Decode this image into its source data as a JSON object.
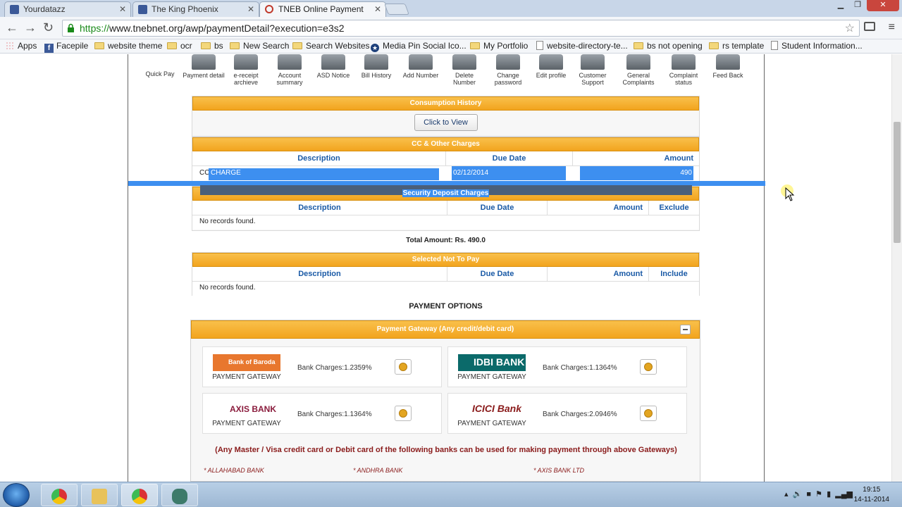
{
  "browser": {
    "tabs": [
      {
        "title": "Yourdatazz",
        "fav_color": "#3b5998"
      },
      {
        "title": "The King Phoenix",
        "fav_color": "#3b5998"
      },
      {
        "title": "TNEB Online Payment",
        "fav_color": "#c0392b"
      }
    ],
    "url_scheme": "https://",
    "url_rest": "www.tnebnet.org/awp/paymentDetail?execution=e3s2",
    "bookmarks": [
      "Apps",
      "Facepile",
      "website theme",
      "ocr",
      "bs",
      "New Search",
      "Search Websites",
      "Media Pin Social Ico...",
      "My Portfolio",
      "website-directory-te...",
      "bs not opening",
      "rs template",
      "Student Information..."
    ]
  },
  "nav_icons": [
    {
      "label": "Quick Pay"
    },
    {
      "label": "Payment detail"
    },
    {
      "label": "e-receipt archieve"
    },
    {
      "label": "Account summary"
    },
    {
      "label": "ASD Notice"
    },
    {
      "label": "Bill History"
    },
    {
      "label": "Add Number"
    },
    {
      "label": "Delete Number"
    },
    {
      "label": "Change password"
    },
    {
      "label": "Edit profile"
    },
    {
      "label": "Customer Support"
    },
    {
      "label": "General Complaints"
    },
    {
      "label": "Complaint status"
    },
    {
      "label": "Feed Back"
    }
  ],
  "consumption": {
    "title": "Consumption History",
    "button": "Click to View"
  },
  "cc_charges": {
    "title": "CC & Other Charges",
    "headers": [
      "Description",
      "Due Date",
      "Amount"
    ],
    "row": {
      "desc_prefix": "CC",
      "desc": "CHARGE",
      "due": "02/12/2014",
      "amount": "490"
    }
  },
  "security": {
    "title": "Security Deposit Charges",
    "headers": [
      "Description",
      "Due Date",
      "Amount",
      "Exclude"
    ],
    "empty": "No records found."
  },
  "total": "Total Amount: Rs. 490.0",
  "not_to_pay": {
    "title": "Selected Not To Pay",
    "headers": [
      "Description",
      "Due Date",
      "Amount",
      "Include"
    ],
    "empty": "No records found."
  },
  "payment_options_title": "PAYMENT OPTIONS",
  "gateway": {
    "title": "Payment Gateway (Any credit/debit card)",
    "banks": [
      {
        "name": "Bank of Baroda",
        "logo_text": "Bank of Baroda",
        "pg": "PAYMENT GATEWAY",
        "charges": "Bank Charges:1.2359%"
      },
      {
        "name": "IDBI BANK",
        "logo_text": "IDBI BANK",
        "pg": "PAYMENT GATEWAY",
        "charges": "Bank Charges:1.1364%"
      },
      {
        "name": "AXIS BANK",
        "logo_text": "AXIS BANK",
        "pg": "PAYMENT GATEWAY",
        "charges": "Bank Charges:1.1364%"
      },
      {
        "name": "ICICI Bank",
        "logo_text": "ICICI Bank",
        "pg": "PAYMENT GATEWAY",
        "charges": "Bank Charges:2.0946%"
      }
    ],
    "note": "(Any Master / Visa credit card or Debit card of the following banks can be used for making payment through above Gateways)",
    "bank_list": [
      "* ALLAHABAD BANK",
      "* ANDHRA BANK",
      "* AXIS BANK LTD"
    ]
  },
  "taskbar": {
    "time": "19:15",
    "date": "14-11-2014"
  },
  "colors": {
    "accent_orange": "#f2a41e",
    "selection_blue": "#3d8ff0",
    "header_blue": "#1a5aa6"
  }
}
